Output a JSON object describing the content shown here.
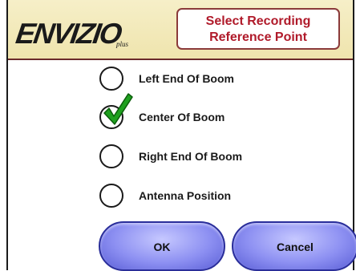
{
  "header": {
    "logo_text": "ENVIZIO",
    "logo_sub": "plus",
    "title_line1": "Select Recording",
    "title_line2": "Reference Point"
  },
  "options": [
    {
      "label": "Left End Of Boom",
      "selected": false
    },
    {
      "label": "Center Of Boom",
      "selected": true
    },
    {
      "label": "Right End Of Boom",
      "selected": false
    },
    {
      "label": "Antenna Position",
      "selected": false
    }
  ],
  "buttons": {
    "ok_label": "OK",
    "cancel_label": "Cancel"
  },
  "colors": {
    "header_bg": "#f2e8b8",
    "title_text": "#b01a2a",
    "button_fill": "#8d90f2",
    "checkmark": "#1fa01f"
  },
  "icons": {
    "selected_marker": "checkmark-icon",
    "unselected_marker": "radio-circle-icon"
  }
}
